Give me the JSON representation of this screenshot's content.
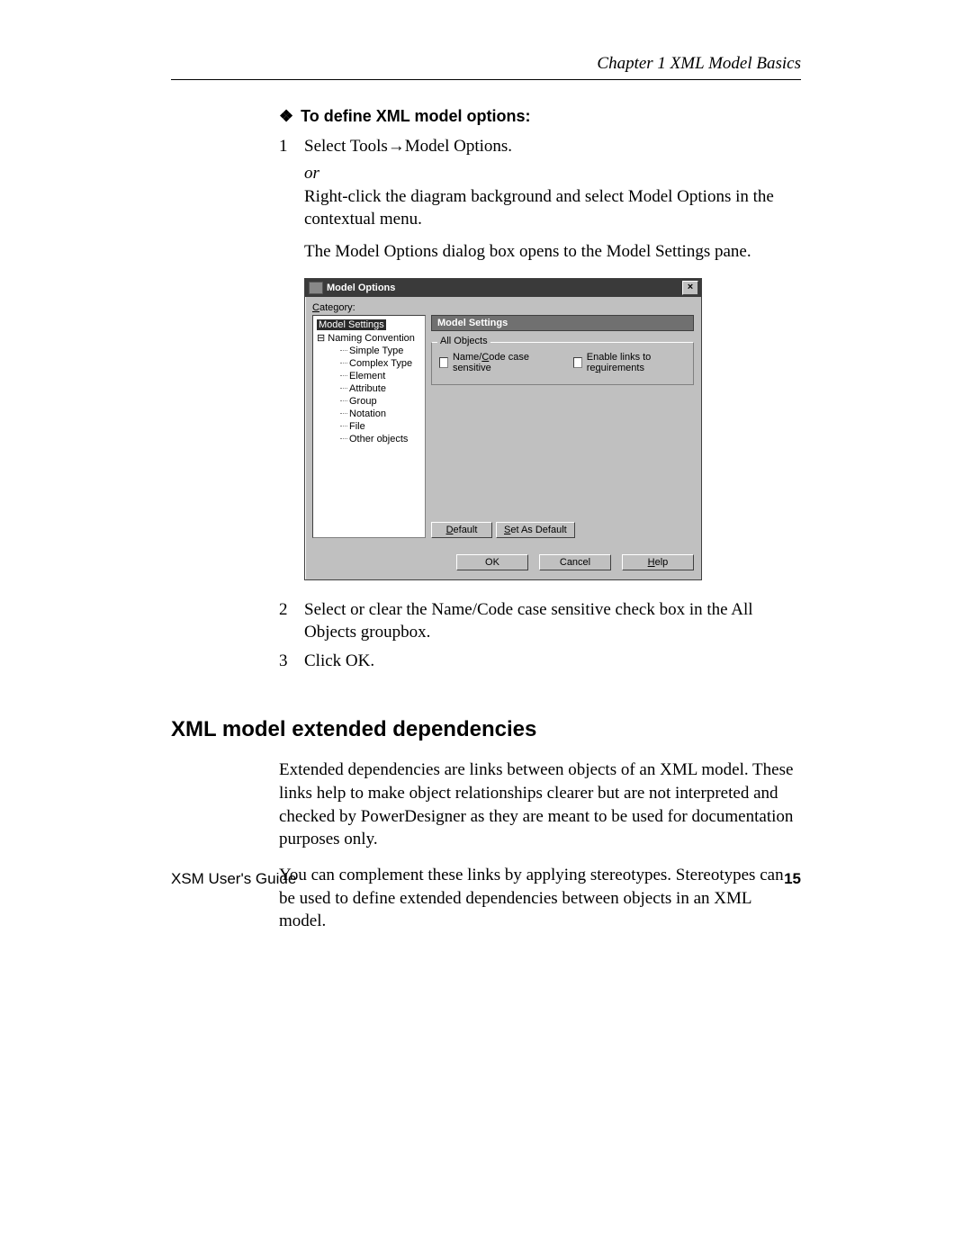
{
  "header": {
    "chapter_label": "Chapter 1    XML Model Basics"
  },
  "procedure": {
    "title": "To define XML model options:",
    "steps": {
      "s1_num": "1",
      "s1_text": "Select Tools→Model Options.",
      "or": "or",
      "s1_alt": "Right-click the diagram background and select Model Options in the contextual menu.",
      "s1_result": "The Model Options dialog box opens to the Model Settings pane.",
      "s2_num": "2",
      "s2_text": "Select or clear the Name/Code case sensitive check box in the All Objects groupbox.",
      "s3_num": "3",
      "s3_text": "Click OK."
    }
  },
  "dialog": {
    "title": "Model Options",
    "close": "×",
    "category_label": "Category:",
    "tree": {
      "model_settings": "Model Settings",
      "naming_convention": "Naming Convention",
      "simple_type": "Simple Type",
      "complex_type": "Complex Type",
      "element": "Element",
      "attribute": "Attribute",
      "group": "Group",
      "notation": "Notation",
      "file": "File",
      "other_objects": "Other objects"
    },
    "pane_header": "Model Settings",
    "groupbox_title": "All Objects",
    "check_name_code": "Name/Code case sensitive",
    "check_links": "Enable links to requirements",
    "btn_default": "Default",
    "btn_set_default": "Set As Default",
    "btn_ok": "OK",
    "btn_cancel": "Cancel",
    "btn_help": "Help"
  },
  "section": {
    "heading": "XML model extended dependencies",
    "p1": "Extended dependencies are links between objects of an XML model. These links help to make object relationships clearer but are not interpreted and checked by PowerDesigner as they are meant to be used for documentation purposes only.",
    "p2": "You can complement these links by applying stereotypes. Stereotypes can be used to define extended dependencies between objects in an XML model."
  },
  "footer": {
    "guide": "XSM User's Guide",
    "page": "15"
  }
}
